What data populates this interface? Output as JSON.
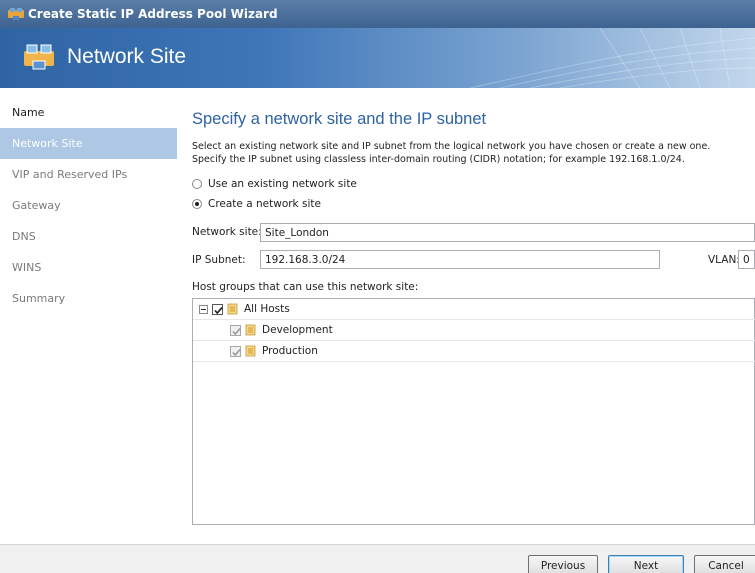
{
  "window": {
    "title": "Create Static IP Address Pool Wizard",
    "icon": "network-site-icon"
  },
  "header": {
    "title": "Network Site",
    "icon": "network-site-icon"
  },
  "sidebar": {
    "items": [
      {
        "label": "Name",
        "state": "done"
      },
      {
        "label": "Network Site",
        "state": "active"
      },
      {
        "label": "VIP and Reserved IPs",
        "state": "pending"
      },
      {
        "label": "Gateway",
        "state": "pending"
      },
      {
        "label": "DNS",
        "state": "pending"
      },
      {
        "label": "WINS",
        "state": "pending"
      },
      {
        "label": "Summary",
        "state": "pending"
      }
    ]
  },
  "main": {
    "heading": "Specify a network site and the IP subnet",
    "description_line1": "Select an existing network site and IP subnet from the logical network you have chosen or create a new one.",
    "description_line2": "Specify the IP subnet using classless inter-domain routing (CIDR) notation; for example 192.168.1.0/24.",
    "radio_existing": {
      "label": "Use an existing network site",
      "checked": false
    },
    "radio_create": {
      "label": "Create a network site",
      "checked": true
    },
    "network_site": {
      "label": "Network site:",
      "value": "Site_London"
    },
    "ip_subnet": {
      "label": "IP Subnet:",
      "value": "192.168.3.0/24"
    },
    "vlan": {
      "label": "VLAN:",
      "value": "0"
    },
    "host_groups_label": "Host groups that can use this network site:",
    "host_groups": {
      "root": {
        "label": "All Hosts",
        "checked": true,
        "expanded": true
      },
      "children": [
        {
          "label": "Development",
          "checked": true,
          "disabled": true
        },
        {
          "label": "Production",
          "checked": true,
          "disabled": true
        }
      ]
    }
  },
  "footer": {
    "previous": "Previous",
    "next": "Next",
    "cancel": "Cancel"
  },
  "colors": {
    "accent_heading": "#2d62a3",
    "sidebar_active": "#aec7e4",
    "title_bar": "#3d6390"
  }
}
